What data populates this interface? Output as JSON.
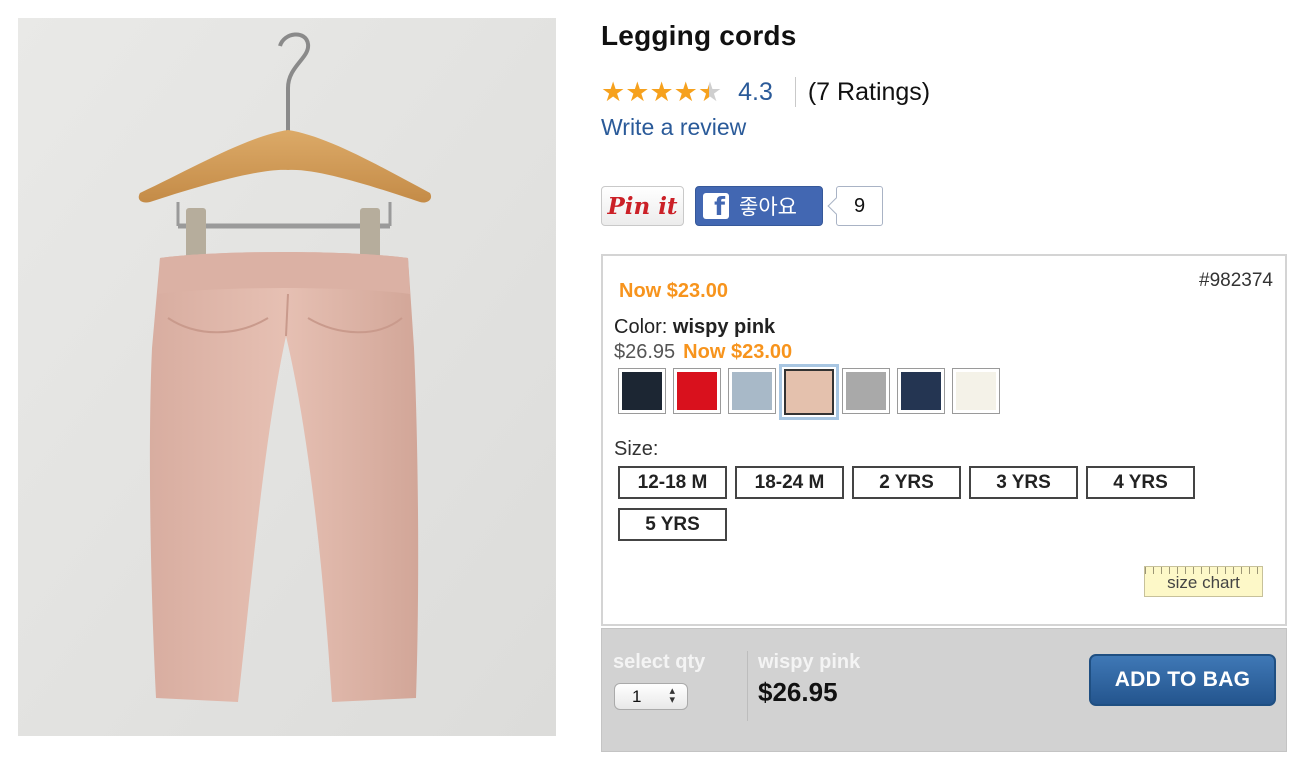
{
  "product": {
    "title": "Legging cords",
    "rating": {
      "stars_value": 4.3,
      "value": "4.3",
      "count_text": "(7 Ratings)"
    },
    "write_review": "Write a review"
  },
  "social": {
    "pin_label": "Pin it",
    "fb_like_label": "좋아요",
    "fb_like_count": "9"
  },
  "options": {
    "sku": "#982374",
    "now_price": "Now $23.00",
    "color_label": "Color:",
    "color_value": "wispy pink",
    "original_price": "$26.95",
    "now_price_inline": "Now $23.00",
    "swatches": [
      {
        "name": "navy",
        "color": "#1c2633",
        "selected": false
      },
      {
        "name": "red",
        "color": "#d9111d",
        "selected": false
      },
      {
        "name": "light blue",
        "color": "#a8b9c8",
        "selected": false
      },
      {
        "name": "wispy pink",
        "color": "#e4c1ad",
        "selected": true
      },
      {
        "name": "grey",
        "color": "#a9a9a9",
        "selected": false
      },
      {
        "name": "dark navy",
        "color": "#243552",
        "selected": false
      },
      {
        "name": "ivory",
        "color": "#f4f2e8",
        "selected": false
      }
    ],
    "size_label": "Size:",
    "sizes": [
      "12-18 M",
      "18-24 M",
      "2 YRS",
      "3 YRS",
      "4 YRS",
      "5 YRS"
    ],
    "size_chart": "size chart"
  },
  "buy_bar": {
    "qty_label": "select qty",
    "qty_value": "1",
    "color_value": "wispy pink",
    "price": "$26.95",
    "add_to_bag": "ADD TO BAG"
  },
  "colors": {
    "link": "#2a5a99",
    "sale": "#f7941d",
    "star": "#f6a11d",
    "button": "#2b5f99"
  }
}
